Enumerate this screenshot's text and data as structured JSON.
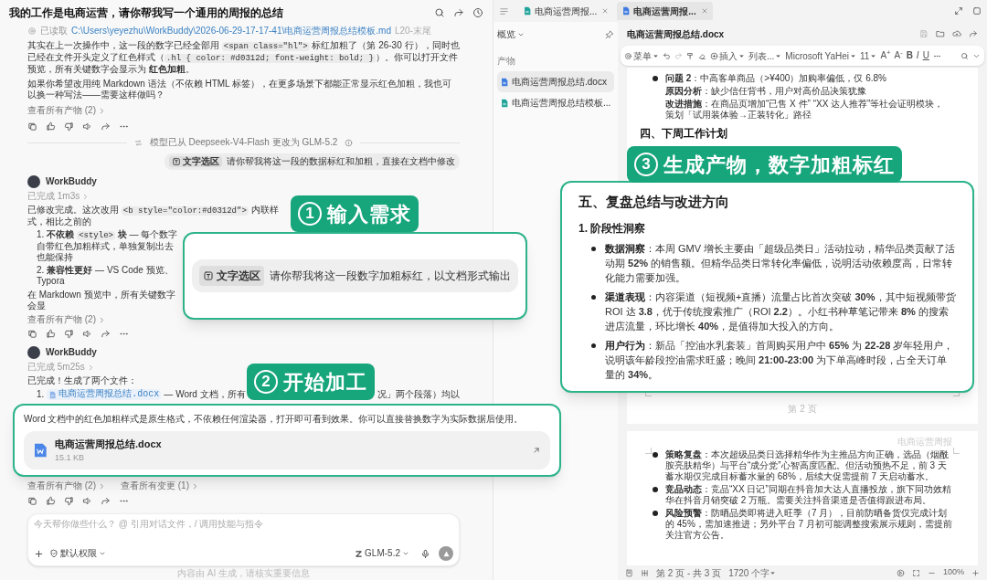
{
  "chat": {
    "title": "我的工作是电商运营，请你帮我写一个通用的周报的总结",
    "file_read": {
      "label": "已读取",
      "path": "C:\\Users\\yeyezhu\\WorkBuddy\\2026-06-29-17-17-41\\电商运营周报总结模板.md",
      "range": "L20-末尾"
    },
    "paragraphs": [
      [
        {
          "kind": "text",
          "text": "其实在上一次操作中，这一段的数字已经全部用 "
        },
        {
          "kind": "code",
          "text": "<span class=\"hl\">"
        },
        {
          "kind": "text",
          "text": " 标红加粗了（第 26-30 行），同时也已经在文件开头定义了红色样式（"
        },
        {
          "kind": "code",
          "text": ".hl { color: #d0312d; font-weight: bold; }"
        },
        {
          "kind": "text",
          "text": "）。你可以打开文件预览，所有关键数字会显示为 **红色加粗**。"
        }
      ],
      [
        {
          "kind": "text",
          "text": "如果你希望改用纯 Markdown 语法（不依赖 HTML 标签），在更多场景下都能正常显示红色加粗，我也可以换一种写法——需要这样做吗？"
        }
      ]
    ],
    "links_1": [
      "查看所有产物 (2)"
    ],
    "model_switch": "模型已从 Deepseek-V4-Flash 更改为 GLM-5.2",
    "user_message": {
      "chip": "文字选区",
      "text": "请你帮我将这一段的数据标红和加粗，直接在文档中修改"
    },
    "reply_1": {
      "author": "WorkBuddy",
      "status": "已完成 1m3s",
      "intro": [
        {
          "kind": "text",
          "text": "已修改完成。这次改用 "
        },
        {
          "kind": "code",
          "text": "<b style=\"color:#d0312d\">"
        },
        {
          "kind": "text",
          "text": " 内联样式，相比之前的"
        }
      ],
      "items": [
        {
          "number": "1.",
          "segments": [
            {
              "kind": "text",
              "text": "**不依赖** "
            },
            {
              "kind": "code",
              "text": "<style>"
            },
            {
              "kind": "text",
              "text": " **块** — 每个数字自带红色加粗样式，单独复制出去也能保持"
            }
          ]
        },
        {
          "number": "2.",
          "segments": [
            {
              "kind": "text",
              "text": "**兼容性更好** — VS Code 预览、Typora"
            }
          ]
        }
      ],
      "note": "在 Markdown 预览中，所有关键数字会显",
      "links": [
        "查看所有产物 (2)"
      ]
    },
    "reply_2": {
      "author": "WorkBuddy",
      "status": "已完成 5m25s",
      "intro": "已完成！生成了两个文件：",
      "item": {
        "number": "1.",
        "file": "电商运营周报总结.docx",
        "text_before": "— Word 文档，所有",
        "text_after": "况」两个段落）均以"
      },
      "links": [
        "查看所有产物 (2)",
        "查看所有变更 (1)"
      ]
    },
    "composer": {
      "placeholder": "今天帮你做些什么？ @ 引用对话文件，/ 调用技能与指令",
      "permission": "默认权限",
      "model": "GLM-5.2"
    },
    "footer": "内容由 AI 生成，请核实重要信息"
  },
  "editor": {
    "tabs": [
      {
        "label": "电商运营周报...",
        "color": "#1fa39a",
        "selected": false
      },
      {
        "label": "电商运营周报...",
        "color": "#3f7be0",
        "selected": true
      }
    ],
    "sidebar": {
      "title": "概览",
      "section": "产物",
      "items": [
        {
          "label": "电商运营周报总结.docx",
          "color": "#3f7be0",
          "selected": true
        },
        {
          "label": "电商运营周报总结模板...",
          "color": "#1fa39a",
          "selected": false
        }
      ]
    },
    "document": {
      "title": "电商运营周报总结.docx",
      "toolbar": {
        "menu": "菜单",
        "insert": "插入",
        "style": "列表...",
        "font": "Microsoft YaHei",
        "size": "11",
        "format_buttons": [
          {
            "kind": "grow",
            "text": "A$^{+}$"
          },
          {
            "kind": "shrink",
            "text": "A$^{-}$"
          },
          {
            "kind": "bold",
            "text": "B"
          },
          {
            "kind": "italic",
            "text": "I"
          },
          {
            "kind": "underline",
            "text": "U"
          }
        ]
      },
      "page_2": {
        "items": [
          {
            "kind": "bullet",
            "label": "问题 2",
            "text": "：中高客单商品（>¥400）加购率偏低，仅 6.8%"
          },
          {
            "kind": "sub",
            "label": "原因分析",
            "text": "：缺少信任背书，用户对高价品决策犹豫"
          },
          {
            "kind": "sub",
            "label": "改进措施",
            "text": "：在商品页增加“已售 X 件” “XX 达人推荐”等社会证明模块，策划「试用装体验→正装转化」路径"
          }
        ],
        "heading": "四、下周工作计划",
        "page_number": "第 2 页"
      },
      "page_3": {
        "header": "电商运营周报",
        "items": [
          {
            "label": "策略复盘",
            "text": "：本次超级品类日选择精华作为主推品方向正确，选品（烟酰胺亮肤精华）与平台“成分党”心智高度匹配。但活动预热不足，前 3 天蓄水期仅完成目标蓄水量的 68%，后续大促需提前 7 天启动蓄水。"
          },
          {
            "label": "竞品动态",
            "text": "：竞品“XX 日记”同期在抖音加大达人直播投放，旗下同功效精华在抖音月销突破 2 万瓶。需要关注抖音渠道是否值得跟进布局。"
          },
          {
            "label": "风险预警",
            "text": "：防晒品类即将进入旺季（7 月），目前防晒备货仅完成计划的 45%，需加速推进；另外平台 7 月初可能调整搜索展示规则，需提前关注官方公告。"
          }
        ]
      }
    },
    "status_bar": {
      "page": "第 2 页 - 共 3 页",
      "words": "1720 个字",
      "zoom": "100%"
    }
  },
  "callouts": [
    {
      "number": "1",
      "label": "输入需求",
      "chip": "文字选区",
      "text": "请你帮我将这一段数字加粗标红，以文档形式输出"
    },
    {
      "number": "2",
      "label": "开始加工",
      "text": "Word 文档中的红色加粗样式是原生格式，不依赖任何渲染器，打开即可看到效果。你可以直接替换数字为实际数据后使用。",
      "file": {
        "name": "电商运营周报总结.docx",
        "size": "15.1 KB"
      }
    },
    {
      "number": "3",
      "label": "生成产物，数字加粗标红",
      "heading": "五、复盘总结与改进方向",
      "subheading": "1. 阶段性洞察",
      "items": [
        {
          "label": "数据洞察",
          "text": "：本周 GMV 增长主要由「超级品类日」活动拉动，精华品类贡献了活动期 **52%** 的销售额。但精华品类日常转化率偏低，说明活动依赖度高，日常转化能力需要加强。"
        },
        {
          "label": "渠道表现",
          "text": "：内容渠道（短视频+直播）流量占比首次突破 **30%**，其中短视频带货 ROI 达 **3.8**，优于传统搜索推广（ROI **2.2**）。小红书种草笔记带来 **8%** 的搜索进店流量，环比增长 **40%**，是值得加大投入的方向。"
        },
        {
          "label": "用户行为",
          "text": "：新品「控油水乳套装」首周购买用户中 **65%** 为 **22-28** 岁年轻用户，说明该年龄段控油需求旺盛；晚间 **21:00-23:00** 为下单高峰时段，占全天订单量的 **34%**。"
        }
      ]
    }
  ]
}
